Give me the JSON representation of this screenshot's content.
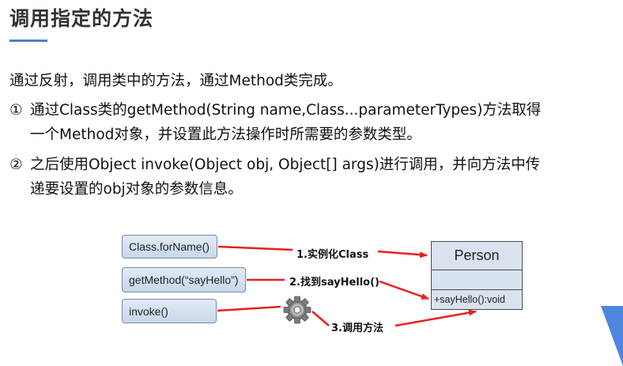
{
  "title": "调用指定的方法",
  "intro": "通过反射，调用类中的方法，通过Method类完成。",
  "items": [
    {
      "number": "①",
      "line1": "通过Class类的getMethod(String name,Class...parameterTypes)方法取得",
      "line2": "一个Method对象，并设置此方法操作时所需要的参数类型。"
    },
    {
      "number": "②",
      "line1": "之后使用Object invoke(Object obj, Object[] args)进行调用，并向方法中传",
      "line2": "递要设置的obj对象的参数信息。"
    }
  ],
  "diagram": {
    "boxes": {
      "forname": "Class.forName()",
      "getmethod": "getMethod(“sayHello”)",
      "invoke": "invoke()"
    },
    "steps": {
      "step1": "1.实例化Class",
      "step2": "2.找到sayHello()",
      "step3": "3.调用方法"
    },
    "uml": {
      "class_name": "Person",
      "attributes": "",
      "method": "+sayHello():void"
    },
    "arrow_color": "#e8201c",
    "box_color": "#d3e0f0"
  }
}
